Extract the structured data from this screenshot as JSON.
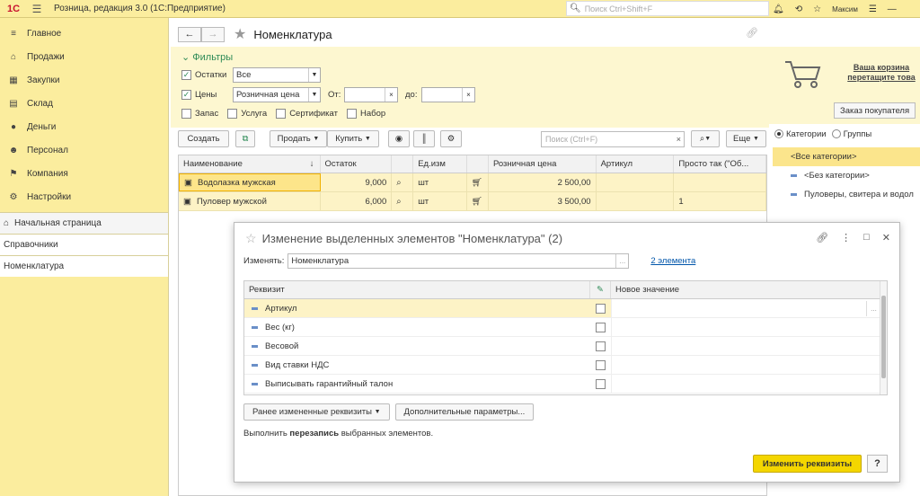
{
  "topbar": {
    "logo": "1С",
    "title": "Розница, редакция 3.0  (1С:Предприятие)",
    "search_placeholder": "Поиск Ctrl+Shift+F",
    "user": "Максим"
  },
  "sidebar": {
    "items": [
      {
        "label": "Главное",
        "icon": "≡"
      },
      {
        "label": "Продажи",
        "icon": "⌂"
      },
      {
        "label": "Закупки",
        "icon": "▦"
      },
      {
        "label": "Склад",
        "icon": "▤"
      },
      {
        "label": "Деньги",
        "icon": "●"
      },
      {
        "label": "Персонал",
        "icon": "☻"
      },
      {
        "label": "Компания",
        "icon": "⚑"
      },
      {
        "label": "Настройки",
        "icon": "⚙"
      }
    ],
    "home": "Начальная страница",
    "open1": "Справочники",
    "open2": "Номенклатура"
  },
  "main": {
    "title": "Номенклатура",
    "filters": {
      "header": "Фильтры",
      "ostatki_label": "Остатки",
      "ostatki_value": "Все",
      "ceny_label": "Цены",
      "ceny_value": "Розничная цена",
      "from_label": "От:",
      "to_label": "до:",
      "zapas": "Запас",
      "usluga": "Услуга",
      "sertifikat": "Сертификат",
      "nabor": "Набор"
    },
    "toolbar": {
      "create": "Создать",
      "sell": "Продать",
      "buy": "Купить",
      "search_placeholder": "Поиск (Ctrl+F)",
      "more": "Еще"
    },
    "columns": [
      "Наименование",
      "Остаток",
      "Ед.изм",
      "Розничная цена",
      "Артикул",
      "Просто так (\"Об..."
    ],
    "rows": [
      {
        "name": "Водолазка мужская",
        "ostatok": "9,000",
        "unit": "шт",
        "price": "2 500,00",
        "article": "",
        "prosto": ""
      },
      {
        "name": "Пуловер мужской",
        "ostatok": "6,000",
        "unit": "шт",
        "price": "3 500,00",
        "article": "",
        "prosto": "1"
      }
    ]
  },
  "right": {
    "cart_line1": "Ваша корзина",
    "cart_line2": "перетащите това",
    "order_button": "Заказ покупателя",
    "radio_categories": "Категории",
    "radio_groups": "Группы",
    "categories": [
      "<Все категории>",
      "<Без категории>",
      "Пуловеры, свитера и водол"
    ]
  },
  "dialog": {
    "title": "Изменение выделенных элементов \"Номенклатура\" (2)",
    "change_label": "Изменять:",
    "change_value": "Номенклатура",
    "elements_link": "2 элемента",
    "col_requisite": "Реквизит",
    "col_new_value": "Новое значение",
    "requisites": [
      "Артикул",
      "Вес (кг)",
      "Весовой",
      "Вид ставки НДС",
      "Выписывать гарантийный талон"
    ],
    "btn_prev": "Ранее измененные реквизиты",
    "btn_more_params": "Дополнительные параметры...",
    "note_prefix": "Выполнить ",
    "note_bold": "перезапись",
    "note_suffix": " выбранных элементов.",
    "btn_apply": "Изменить реквизиты",
    "btn_help": "?"
  }
}
